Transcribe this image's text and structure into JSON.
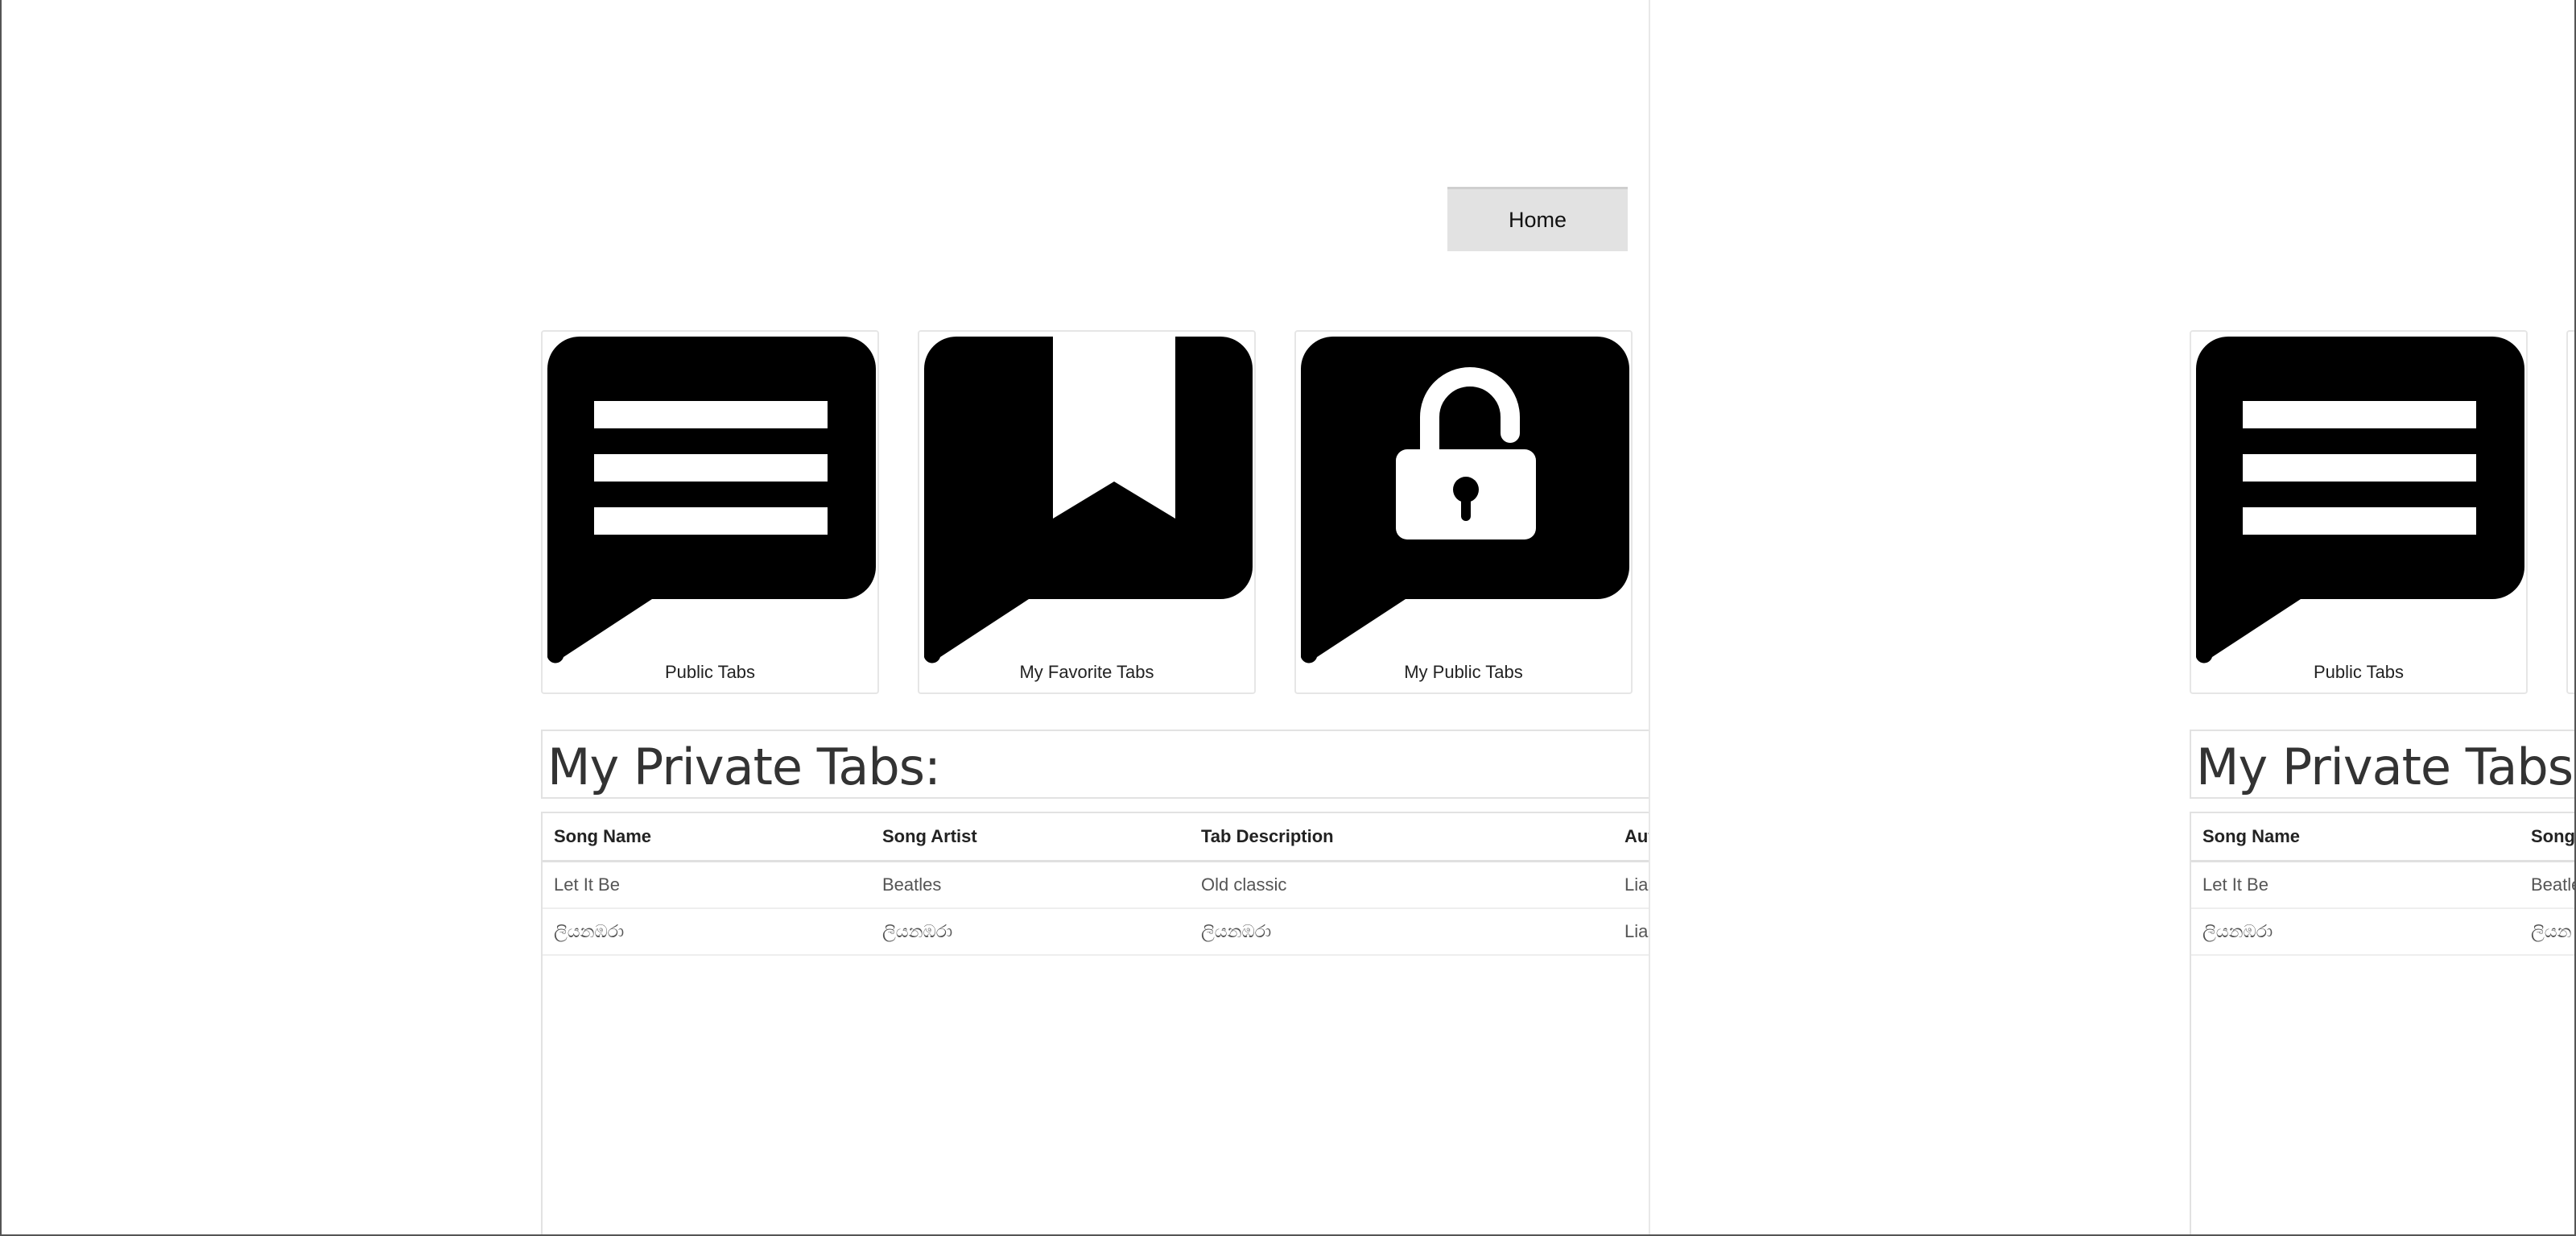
{
  "nav": {
    "home_label": "Home"
  },
  "cards": [
    {
      "icon": "chat-lines-icon",
      "label": "Public Tabs"
    },
    {
      "icon": "bookmark-icon",
      "label": "My Favorite Tabs"
    },
    {
      "icon": "unlock-icon",
      "label": "My Public Tabs"
    }
  ],
  "section": {
    "title": "My Private Tabs:"
  },
  "table": {
    "columns": [
      "Song Name",
      "Song Artist",
      "Tab Description",
      "Aut"
    ],
    "rows": [
      [
        "Let It Be",
        "Beatles",
        "Old classic",
        "Lia"
      ],
      [
        "ලියනඹරා",
        "ලියනඹරා",
        "ලියනඹරා",
        "Lia"
      ]
    ]
  },
  "right_pane": {
    "table_columns": [
      "Song Name",
      "Song A"
    ],
    "rows": [
      [
        "Let It Be",
        "Beatle"
      ],
      [
        "ලියනඹරා",
        "ලියන"
      ]
    ]
  },
  "colors": {
    "banner": "#046d98",
    "button_bg": "#e2e2e2"
  }
}
